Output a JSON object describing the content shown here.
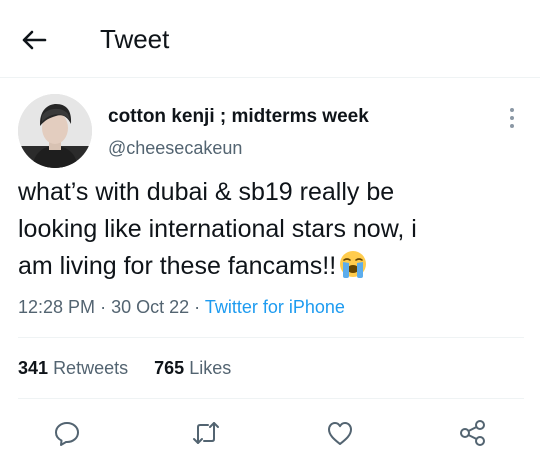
{
  "header": {
    "title": "Tweet",
    "back_icon": "arrow-left-icon"
  },
  "tweet": {
    "author": {
      "display_name": "cotton kenji ; midterms week",
      "handle": "@cheesecakeun",
      "avatar_icon": "avatar"
    },
    "text_lines": [
      "what’s with dubai & sb19 really be",
      "looking like international stars now, i",
      "am living for these fancams!!"
    ],
    "emoji": "loudly-crying-face-emoji",
    "time": "12:28 PM",
    "separator": "·",
    "date": "30 Oct 22",
    "source": "Twitter for iPhone",
    "more_icon": "more-vertical-icon"
  },
  "stats": {
    "retweets_count": "341",
    "retweets_label": "Retweets",
    "likes_count": "765",
    "likes_label": "Likes"
  },
  "actions": [
    {
      "icon": "reply-icon"
    },
    {
      "icon": "retweet-icon"
    },
    {
      "icon": "like-icon"
    },
    {
      "icon": "share-icon"
    }
  ],
  "colors": {
    "text": "#0f1419",
    "secondary": "#536471",
    "link": "#1d9bf0",
    "divider": "#eff3f4"
  }
}
